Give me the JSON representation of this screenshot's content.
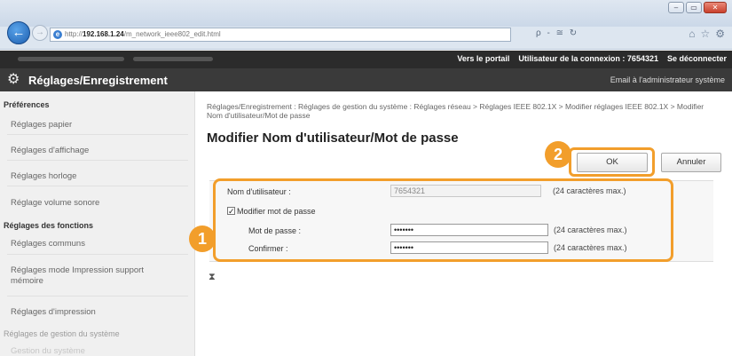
{
  "browser": {
    "url_prefix": "http://",
    "url_host": "192.168.1.24",
    "url_path": "/m_network_ieee802_edit.html",
    "url_tools": "ρ - ≅ ↻",
    "back_icon": "back-arrow-icon",
    "forward_icon": "forward-arrow-icon"
  },
  "topbar": {
    "portal_link": "Vers le portail",
    "user_label": "Utilisateur de la connexion : 7654321",
    "logout_link": "Se déconnecter"
  },
  "header": {
    "title": "Réglages/Enregistrement",
    "mail_admin": "Email à l'administrateur système"
  },
  "sidebar": {
    "sections": [
      {
        "heading": "Préférences",
        "items": [
          "Réglages papier",
          "Réglages d'affichage",
          "Réglages horloge",
          "Réglage volume sonore"
        ]
      },
      {
        "heading": "Réglages des fonctions",
        "items": [
          "Réglages communs",
          "Réglages mode Impression support mémoire",
          "Réglages d'impression"
        ]
      },
      {
        "heading": "Réglages de gestion du système",
        "items": [
          "Gestion du système"
        ]
      }
    ]
  },
  "main": {
    "breadcrumb": "Réglages/Enregistrement : Réglages de gestion du système : Réglages réseau > Réglages IEEE 802.1X > Modifier réglages IEEE 802.1X > Modifier Nom d'utilisateur/Mot de passe",
    "title": "Modifier Nom d'utilisateur/Mot de passe",
    "ok_label": "OK",
    "cancel_label": "Annuler",
    "badge1": "1",
    "badge2": "2",
    "to_top": "⧗"
  },
  "form": {
    "username_label": "Nom d'utilisateur :",
    "username_value": "7654321",
    "username_hint": "(24 caractères max.)",
    "change_password_label": "Modifier mot de passe",
    "change_password_checked": true,
    "password_label": "Mot de passe :",
    "password_value": "•••••••",
    "password_hint": "(24 caractères max.)",
    "confirm_label": "Confirmer :",
    "confirm_value": "•••••••",
    "confirm_hint": "(24 caractères max.)"
  },
  "colors": {
    "accent": "#f29e2b",
    "header_dark": "#2b2b2b",
    "sidebar_bg": "#f0f0f0"
  }
}
